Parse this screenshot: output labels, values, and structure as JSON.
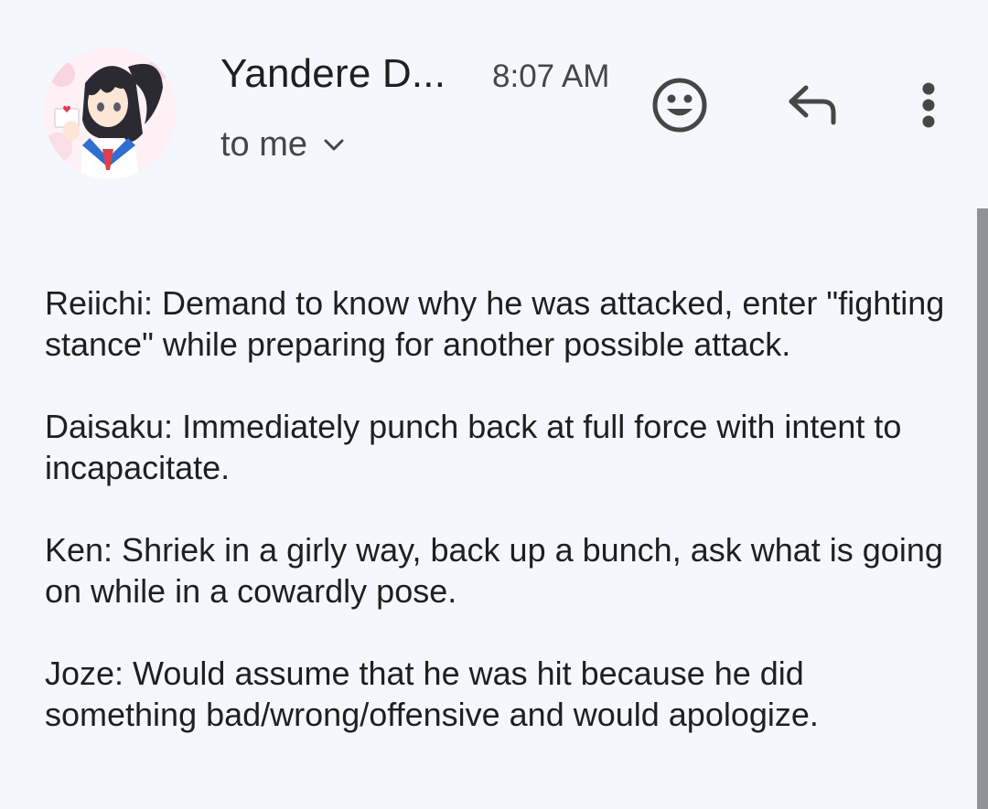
{
  "header": {
    "sender_name": "Yandere D...",
    "time": "8:07 AM",
    "recipient_label": "to me",
    "icons": {
      "avatar": "profile-picture-anime-girl",
      "recipients_toggle": "chevron-down-icon",
      "emoji_reaction": "emoji-smile-icon",
      "reply": "reply-icon",
      "more": "more-vert-icon"
    }
  },
  "body": {
    "paragraphs": [
      "Reiichi: Demand to know why he was attacked, enter \"fighting stance\" while preparing for another possible attack.",
      "Daisaku: Immediately punch back at full force with intent to incapacitate.",
      "Ken: Shriek in a girly way, back up a bunch, ask what is going on while in a cowardly pose.",
      "Joze: Would assume that he was hit because he did something bad/wrong/offensive and would apologize."
    ]
  },
  "colors": {
    "background": "#f4f8fc",
    "text_primary": "#1f1f1f",
    "text_secondary": "#444746",
    "scrollbar": "#8f9296"
  }
}
